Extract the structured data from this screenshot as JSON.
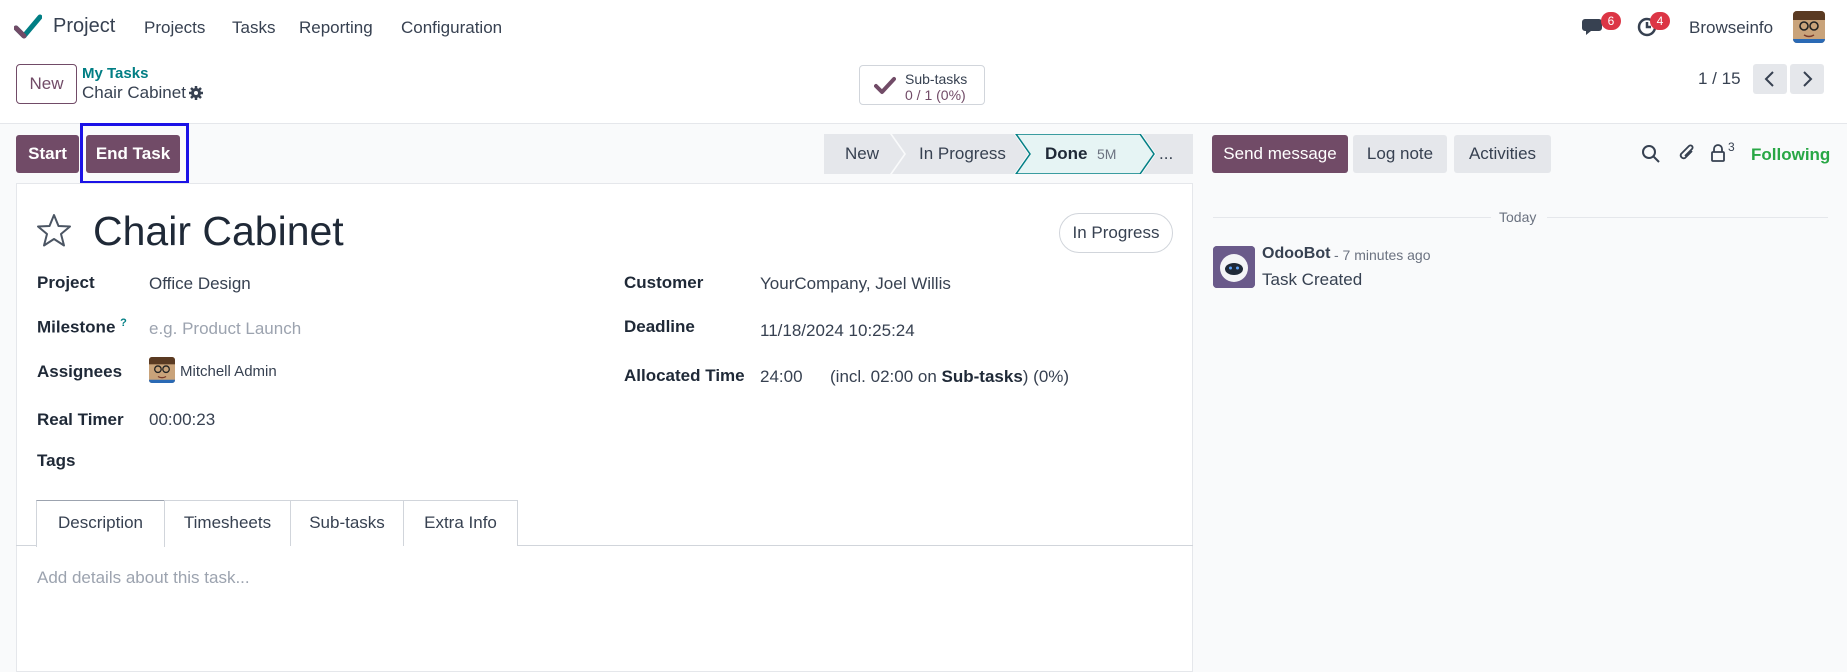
{
  "navbar": {
    "app_name": "Project",
    "menu": [
      "Projects",
      "Tasks",
      "Reporting",
      "Configuration"
    ],
    "messages_count": "6",
    "activities_count": "4",
    "user_name": "Browseinfo"
  },
  "control": {
    "new_label": "New",
    "breadcrumb_parent": "My Tasks",
    "breadcrumb_current": "Chair Cabinet",
    "subtasks_label": "Sub-tasks",
    "subtasks_value": "0 / 1 (0%)",
    "pager": "1 / 15"
  },
  "actions": {
    "start": "Start",
    "end_task": "End Task"
  },
  "stages": {
    "new": "New",
    "in_progress": "In Progress",
    "done": "Done",
    "done_duration": "5M",
    "more": "..."
  },
  "chatter_actions": {
    "send_message": "Send message",
    "log_note": "Log note",
    "activities": "Activities",
    "followers_count": "3",
    "following": "Following"
  },
  "form": {
    "title": "Chair Cabinet",
    "status": "In Progress",
    "fields_left": [
      {
        "label": "Project",
        "value": "Office Design"
      },
      {
        "label": "Milestone",
        "help": "?",
        "placeholder": "e.g. Product Launch"
      },
      {
        "label": "Assignees",
        "value": "Mitchell Admin"
      },
      {
        "label": "Real Timer",
        "value": "00:00:23"
      },
      {
        "label": "Tags",
        "value": ""
      }
    ],
    "fields_right": [
      {
        "label": "Customer",
        "value": "YourCompany, Joel Willis"
      },
      {
        "label": "Deadline",
        "value": "11/18/2024 10:25:24"
      },
      {
        "label": "Allocated Time",
        "value": "24:00",
        "extra_pre": "(incl. 02:00 on",
        "extra_bold": "Sub-tasks",
        "extra_post": ") (0%)"
      }
    ],
    "tabs": [
      "Description",
      "Timesheets",
      "Sub-tasks",
      "Extra Info"
    ],
    "description_placeholder": "Add details about this task..."
  },
  "chatter": {
    "date_separator": "Today",
    "messages": [
      {
        "author": "OdooBot",
        "time": "- 7 minutes ago",
        "body": "Task Created"
      }
    ]
  },
  "colors": {
    "brand": "#714b67",
    "accent_teal": "#017e84",
    "following_green": "#28a745",
    "badge_red": "#dc3545",
    "highlight_blue": "#1b12e6"
  }
}
